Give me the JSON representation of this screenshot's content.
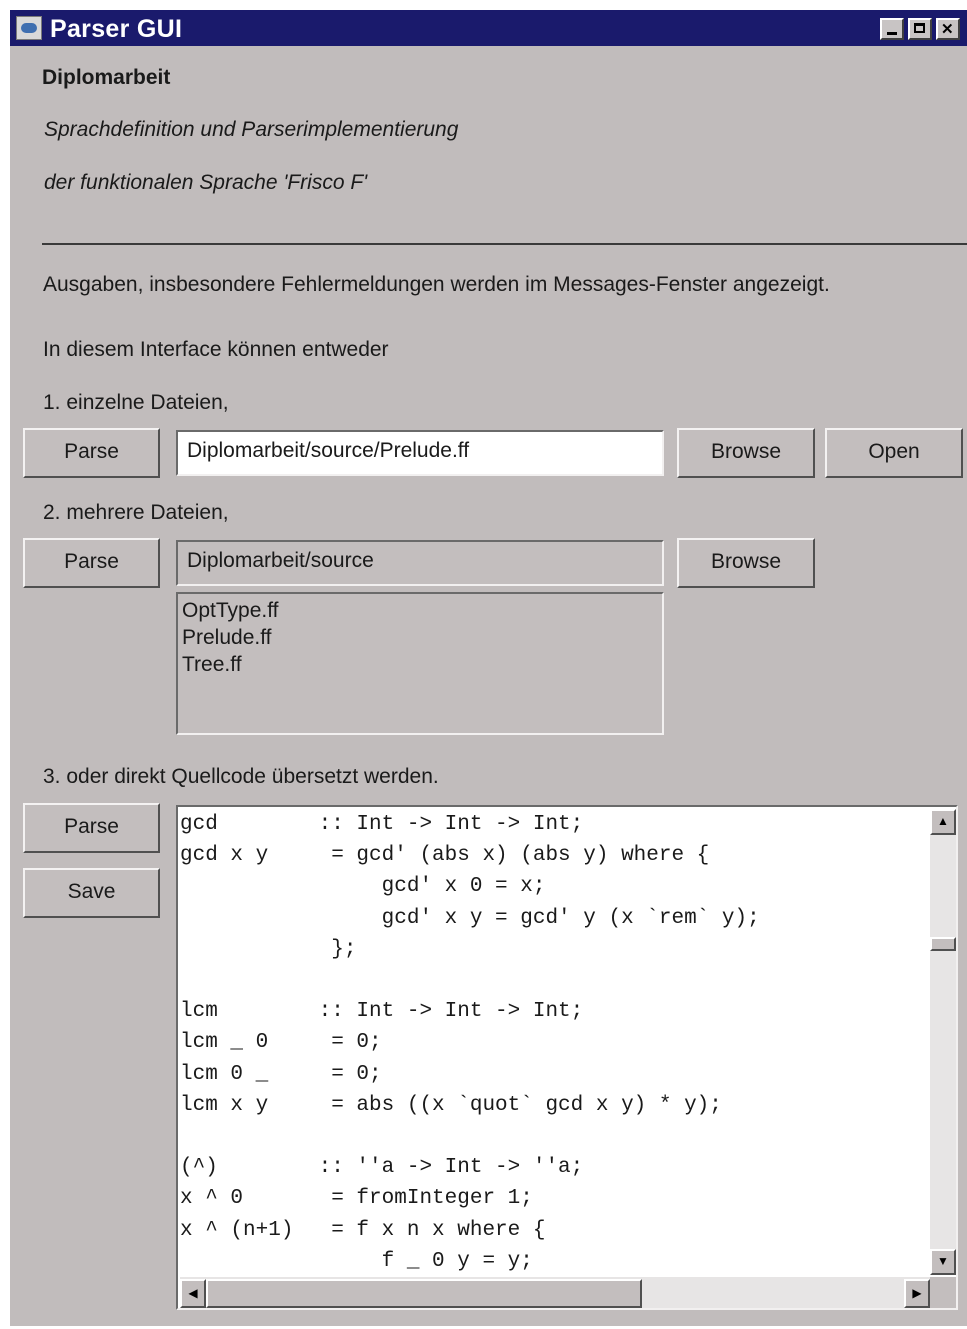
{
  "window": {
    "title": "Parser GUI"
  },
  "header": {
    "heading": "Diplomarbeit",
    "subtitle_line1": "Sprachdefinition und Parserimplementierung",
    "subtitle_line2": "der funktionalen Sprache 'Frisco F'"
  },
  "info": {
    "messages_note": "Ausgaben, insbesondere Fehlermeldungen werden im Messages-Fenster angezeigt.",
    "interface_intro": "In diesem Interface können entweder"
  },
  "section1": {
    "label": "1. einzelne Dateien,",
    "parse_label": "Parse",
    "file_path": "Diplomarbeit/source/Prelude.ff",
    "browse_label": "Browse",
    "open_label": "Open"
  },
  "section2": {
    "label": "2. mehrere Dateien,",
    "parse_label": "Parse",
    "dir_path": "Diplomarbeit/source",
    "browse_label": "Browse",
    "files": [
      "OptType.ff",
      "Prelude.ff",
      "Tree.ff"
    ]
  },
  "section3": {
    "label": "3. oder direkt Quellcode übersetzt werden.",
    "parse_label": "Parse",
    "save_label": "Save",
    "code": "gcd        :: Int -> Int -> Int;\ngcd x y     = gcd' (abs x) (abs y) where {\n                gcd' x 0 = x;\n                gcd' x y = gcd' y (x `rem` y);\n            };\n\nlcm        :: Int -> Int -> Int;\nlcm _ 0     = 0;\nlcm 0 _     = 0;\nlcm x y     = abs ((x `quot` gcd x y) * y);\n\n(^)        :: ''a -> Int -> ''a;\nx ^ 0       = fromInteger 1;\nx ^ (n+1)   = f x n x where {\n                f _ 0 y = y;"
  },
  "icons": {
    "app": "java-cup-icon",
    "minimize": "minimize-icon",
    "maximize": "maximize-icon",
    "close": "close-icon",
    "scroll_up": "arrow-up-icon",
    "scroll_down": "arrow-down-icon",
    "scroll_left": "arrow-left-icon",
    "scroll_right": "arrow-right-icon"
  },
  "colors": {
    "titlebar": "#1a1a6c",
    "window_bg": "#c1bcbc"
  }
}
